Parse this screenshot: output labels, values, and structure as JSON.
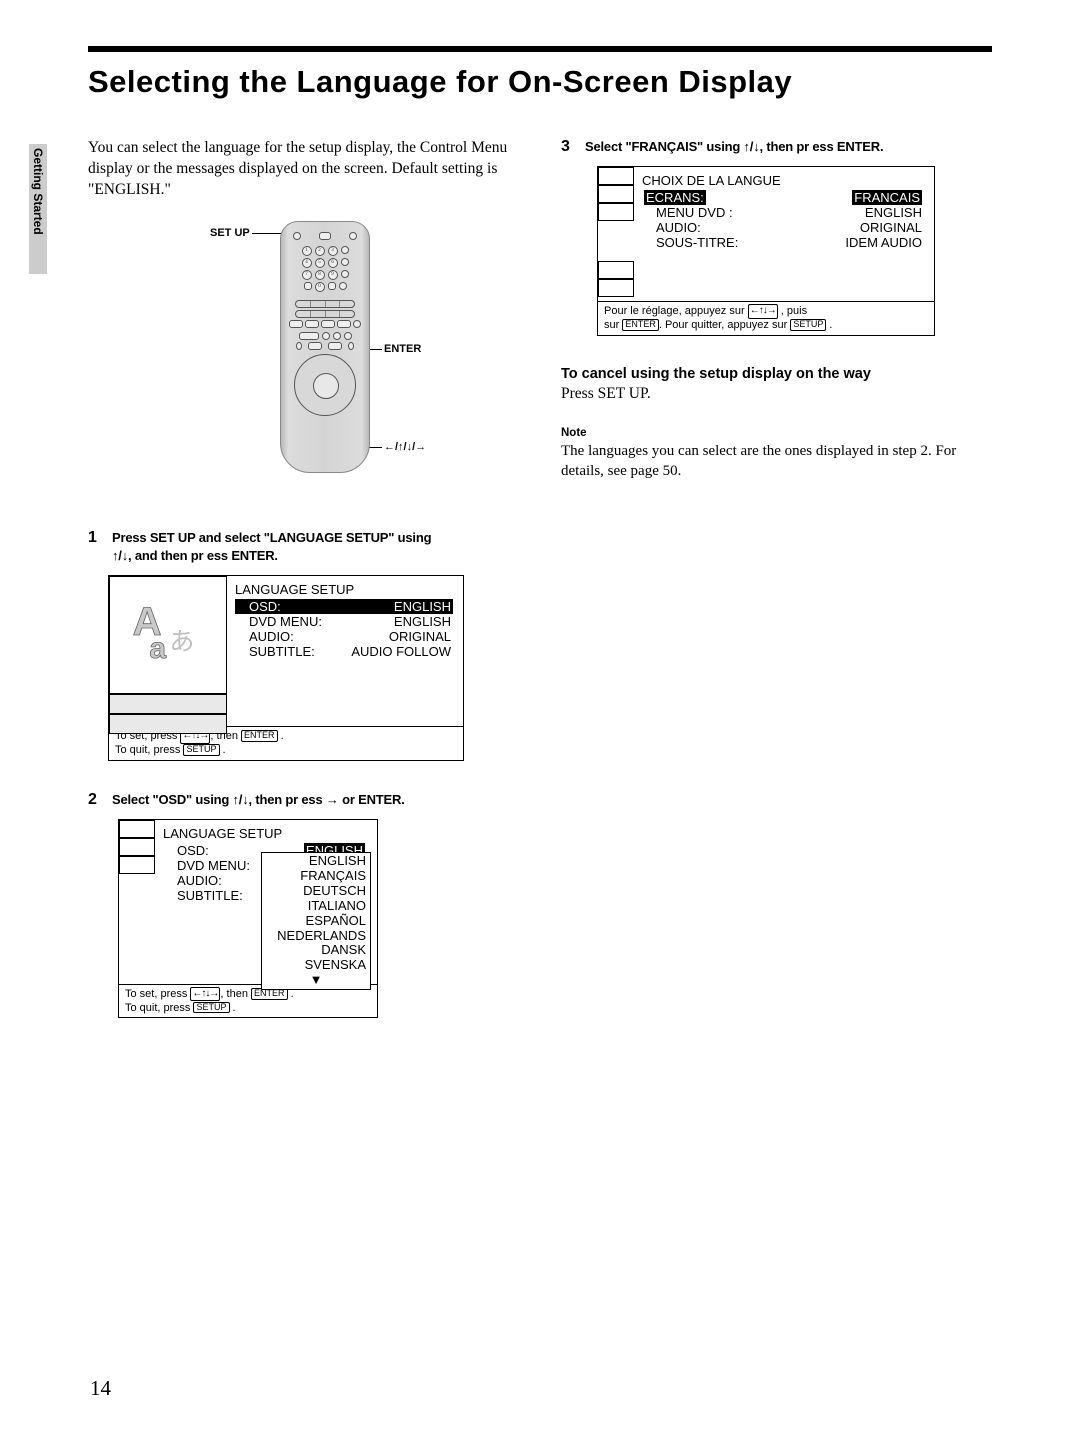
{
  "sideTab": "Getting Started",
  "title": "Selecting the Language for On-Screen Display",
  "intro": "You can select the language for the setup display, the Control Menu display or the messages displayed on the screen.  Default setting is \"ENGLISH.\"",
  "remote": {
    "labelSetup": "SET UP",
    "labelEnter": "ENTER",
    "labelArrows": "←/↑/↓/→"
  },
  "step1": {
    "num": "1",
    "text_a": "Press SET UP and select \"LANGUAGE SETUP\" using",
    "text_b": "↑/↓, and then pr ess ENTER."
  },
  "menu1": {
    "title": "LANGUAGE SETUP",
    "rows": [
      {
        "k": "OSD:",
        "v": "ENGLISH",
        "hl": true
      },
      {
        "k": "DVD MENU:",
        "v": "ENGLISH"
      },
      {
        "k": "AUDIO:",
        "v": "ORIGINAL"
      },
      {
        "k": "SUBTITLE:",
        "v": "AUDIO FOLLOW"
      }
    ],
    "footer1": "To set, press",
    "footer_then": ", then",
    "footer_enter": "ENTER",
    "footer2": "To quit, press",
    "footer_setup": "SETUP"
  },
  "step2": {
    "num": "2",
    "text_a": "Select \"OSD\" using      ↑/↓, then pr ess → or ENTER."
  },
  "menu2": {
    "title": "LANGUAGE SETUP",
    "rows": [
      {
        "k": "OSD:",
        "v": "ENGLISH",
        "hlr": true
      },
      {
        "k": "DVD MENU:",
        "v": ""
      },
      {
        "k": "AUDIO:",
        "v": ""
      },
      {
        "k": "SUBTITLE:",
        "v": ""
      }
    ],
    "dropdown": [
      "ENGLISH",
      "FRANÇAIS",
      "DEUTSCH",
      "ITALIANO",
      "ESPAÑOL",
      "NEDERLANDS",
      "DANSK",
      "SVENSKA"
    ],
    "footer1": "To set, press",
    "footer_then": ", then",
    "footer_enter": "ENTER",
    "footer2": "To quit, press",
    "footer_setup": "SETUP"
  },
  "step3": {
    "num": "3",
    "text_a": "Select \"FRANÇAIS\" using       ↑/↓, then pr ess ENTER."
  },
  "menu3": {
    "title": "CHOIX DE LA LANGUE",
    "rows": [
      {
        "k": "ECRANS:",
        "v": "FRANCAIS",
        "hlboth": true
      },
      {
        "k": "MENU DVD :",
        "v": "ENGLISH"
      },
      {
        "k": "AUDIO:",
        "v": "ORIGINAL"
      },
      {
        "k": "SOUS-TITRE:",
        "v": "IDEM AUDIO"
      }
    ],
    "footer1": "Pour le réglage, appuyez sur",
    "footer_then": ", puis",
    "footer2a": "sur",
    "footer_enter": "ENTER",
    "footer2b": ". Pour quitter, appuyez sur",
    "footer_setup": "SETUP"
  },
  "cancelHead": "To cancel using the setup display on the way",
  "cancelBody": "Press SET UP.",
  "noteLabel": "Note",
  "noteBody": "The languages you can select are the ones displayed in step 2. For details, see page 50.",
  "pageNum": "14"
}
